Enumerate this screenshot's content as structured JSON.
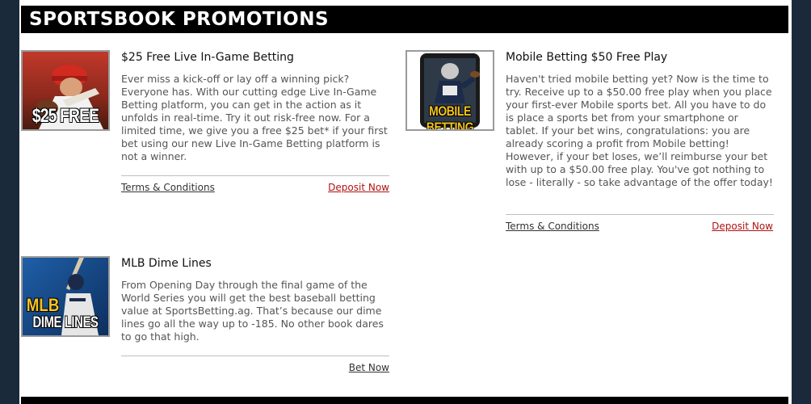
{
  "header": {
    "title": "SPORTSBOOK PROMOTIONS"
  },
  "promos": [
    {
      "title": "$25 Free Live In-Game Betting",
      "image_label": "$25 FREE",
      "body": "Ever miss a kick-off or lay off a winning pick? Everyone has. With our cutting edge Live In-Game Betting platform, you can get in the action as it unfolds in real-time. Try it out risk-free now. For a limited time, we give you a free $25 bet* if your first bet using our new Live In-Game Betting platform is not a winner.",
      "terms_label": "Terms & Conditions",
      "action_label": "Deposit Now"
    },
    {
      "title": "Mobile Betting $50 Free Play",
      "image_label": "MOBILE BETTING",
      "body": "Haven't tried mobile betting yet? Now is the time to try. Receive up to a $50.00 free play when you place your first-ever Mobile sports bet. All you have to do is place a sports bet from your smartphone or tablet. If your bet wins, congratulations: you are already scoring a profit from Mobile betting! However, if your bet loses, we’ll reimburse your bet with up to a $50.00 free play. You've got nothing to lose - literally - so take advantage of the offer today!",
      "terms_label": "Terms & Conditions",
      "action_label": "Deposit Now"
    },
    {
      "title": "MLB Dime Lines",
      "image_label_line1": "MLB",
      "image_label_line2": "DIME LINES",
      "body": "From Opening Day through the final game of the World Series you will get the best baseball betting value at SportsBetting.ag. That’s because our dime lines go all the way up to -185. No other book dares to go that high.",
      "action_label": "Bet Now"
    }
  ],
  "colors": {
    "page_bg": "#1b2a3a",
    "banner_bg": "#000000",
    "deposit_link": "#b01212",
    "body_text": "#555555"
  }
}
